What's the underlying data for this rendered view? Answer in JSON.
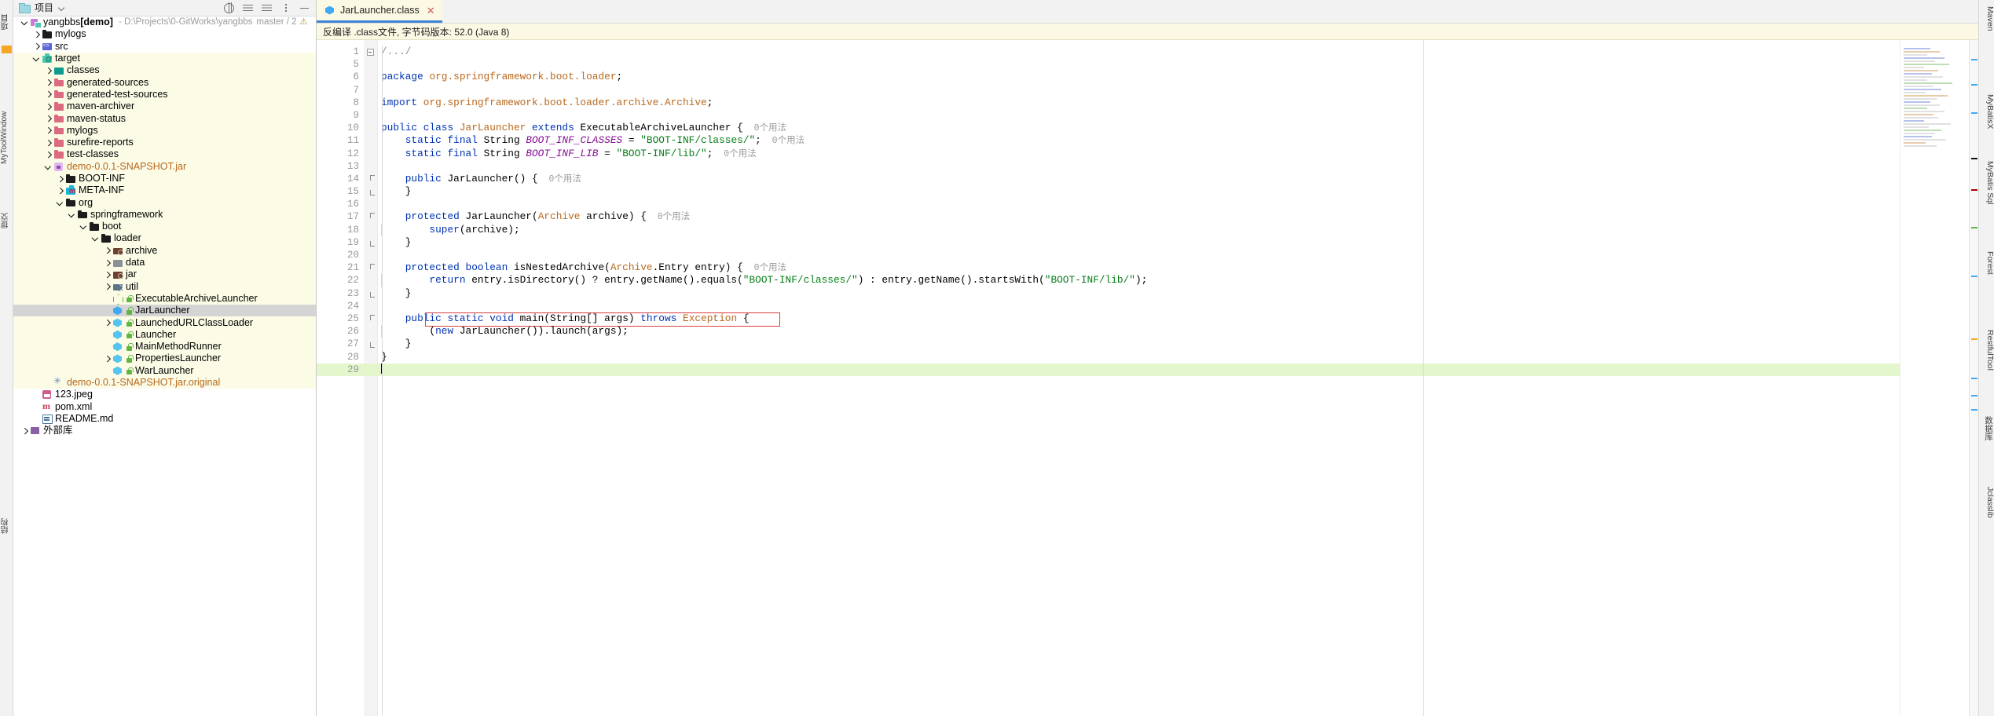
{
  "left_rail": {
    "project_label": "项目",
    "mytoolwindow_label": "MyToolWindow",
    "commit_label": "提交",
    "tiny_label": "结构"
  },
  "project_panel": {
    "header": {
      "title": "项目",
      "folder_icon": "folder-icon",
      "chevron_icon": "chevron-down-icon",
      "tools": [
        "globe-icon",
        "collapse-all-icon",
        "sort-icon",
        "more-options-icon",
        "hide-icon"
      ]
    },
    "tree": [
      {
        "depth": 0,
        "twist": "down",
        "icon": "module",
        "label": "yangbbs",
        "bold_suffix": "[demo]",
        "path": "- D:\\Projects\\0-GitWorks\\yangbbs",
        "branch": "master / 2",
        "warn": "⚠",
        "hl": false
      },
      {
        "depth": 1,
        "twist": "right",
        "icon": "fold black",
        "label": "mylogs",
        "hl": false
      },
      {
        "depth": 1,
        "twist": "right",
        "icon": "src",
        "label": "src",
        "hl": false
      },
      {
        "depth": 1,
        "twist": "down",
        "icon": "fold mint target",
        "label": "target",
        "hl": true
      },
      {
        "depth": 2,
        "twist": "right",
        "icon": "fold teal classesfold",
        "label": "classes",
        "hl": true
      },
      {
        "depth": 2,
        "twist": "right",
        "icon": "fold pink",
        "label": "generated-sources",
        "hl": true
      },
      {
        "depth": 2,
        "twist": "right",
        "icon": "fold pink",
        "label": "generated-test-sources",
        "hl": true
      },
      {
        "depth": 2,
        "twist": "right",
        "icon": "fold pink",
        "label": "maven-archiver",
        "hl": true
      },
      {
        "depth": 2,
        "twist": "right",
        "icon": "fold pink",
        "label": "maven-status",
        "hl": true
      },
      {
        "depth": 2,
        "twist": "right",
        "icon": "fold pink",
        "label": "mylogs",
        "hl": true
      },
      {
        "depth": 2,
        "twist": "right",
        "icon": "fold pink",
        "label": "surefire-reports",
        "hl": true
      },
      {
        "depth": 2,
        "twist": "right",
        "icon": "fold pink",
        "label": "test-classes",
        "hl": true
      },
      {
        "depth": 2,
        "twist": "down",
        "icon": "jarfile",
        "label": "demo-0.0.1-SNAPSHOT.jar",
        "orange": true,
        "hl": true
      },
      {
        "depth": 3,
        "twist": "right",
        "icon": "fold black",
        "label": "BOOT-INF",
        "hl": true
      },
      {
        "depth": 3,
        "twist": "right",
        "icon": "fold cyan metainf",
        "label": "META-INF",
        "hl": true
      },
      {
        "depth": 3,
        "twist": "down",
        "icon": "fold black",
        "label": "org",
        "hl": true
      },
      {
        "depth": 4,
        "twist": "down",
        "icon": "fold black",
        "label": "springframework",
        "hl": true
      },
      {
        "depth": 5,
        "twist": "down",
        "icon": "fold black",
        "label": "boot",
        "hl": true
      },
      {
        "depth": 6,
        "twist": "down",
        "icon": "fold black",
        "label": "loader",
        "hl": true
      },
      {
        "depth": 7,
        "twist": "right",
        "icon": "fold brown archfold",
        "label": "archive",
        "hl": true
      },
      {
        "depth": 7,
        "twist": "right",
        "icon": "fold gray datafold",
        "label": "data",
        "hl": true
      },
      {
        "depth": 7,
        "twist": "right",
        "icon": "fold brown archfold",
        "label": "jar",
        "hl": true
      },
      {
        "depth": 7,
        "twist": "right",
        "icon": "fold slate utilfold",
        "label": "util",
        "hl": true
      },
      {
        "depth": 7,
        "twist": "none",
        "icon": "clsg lockicon",
        "label": "ExecutableArchiveLauncher",
        "hl": true
      },
      {
        "depth": 7,
        "twist": "none",
        "icon": "cls lockicon",
        "label": "JarLauncher",
        "selected": true
      },
      {
        "depth": 7,
        "twist": "right",
        "icon": "clsb lockicon",
        "label": "LaunchedURLClassLoader",
        "hl": true
      },
      {
        "depth": 7,
        "twist": "none",
        "icon": "clsb lockicon",
        "label": "Launcher",
        "hl": true
      },
      {
        "depth": 7,
        "twist": "none",
        "icon": "clsb lockicon",
        "label": "MainMethodRunner",
        "hl": true
      },
      {
        "depth": 7,
        "twist": "right",
        "icon": "clsb lockicon",
        "label": "PropertiesLauncher",
        "hl": true
      },
      {
        "depth": 7,
        "twist": "none",
        "icon": "clsb lockicon",
        "label": "WarLauncher",
        "hl": true
      },
      {
        "depth": 2,
        "twist": "none",
        "icon": "jarorig",
        "label": "demo-0.0.1-SNAPSHOT.jar.original",
        "orange": true,
        "hl": true
      },
      {
        "depth": 1,
        "twist": "none",
        "icon": "img",
        "label": "123.jpeg",
        "hl": false
      },
      {
        "depth": 1,
        "twist": "none",
        "icon": "xml",
        "label": "pom.xml",
        "hl": false
      },
      {
        "depth": 1,
        "twist": "none",
        "icon": "md",
        "label": "README.md",
        "hl": false
      },
      {
        "depth": 0,
        "twist": "right",
        "icon": "ext",
        "label": "外部库",
        "hl": false
      }
    ]
  },
  "editor": {
    "tab": {
      "label": "JarLauncher.class",
      "icon": "java-class-icon",
      "close_icon": "close-icon"
    },
    "notice": "反编译 .class文件, 字节码版本: 52.0 (Java 8)",
    "lines": [
      {
        "num": "1",
        "fold": "plus",
        "tokens": [
          {
            "t": "/...",
            "c": "cmt"
          },
          {
            "t": "/",
            "c": "cmt"
          }
        ]
      },
      {
        "num": "5",
        "tokens": []
      },
      {
        "num": "6",
        "tokens": [
          {
            "t": "package ",
            "c": "k"
          },
          {
            "t": "org.springframework.boot.",
            "c": "cls"
          },
          {
            "t": "loader",
            "c": "cls"
          },
          {
            "t": ";",
            "c": "pl"
          }
        ]
      },
      {
        "num": "7",
        "tokens": []
      },
      {
        "num": "8",
        "tokens": [
          {
            "t": "import ",
            "c": "k"
          },
          {
            "t": "org.springframework.boot.loader.archive.",
            "c": "cls"
          },
          {
            "t": "Archive",
            "c": "cls"
          },
          {
            "t": ";",
            "c": "pl"
          }
        ]
      },
      {
        "num": "9",
        "tokens": []
      },
      {
        "num": "10",
        "run": true,
        "tokens": [
          {
            "t": "public class ",
            "c": "k"
          },
          {
            "t": "JarLauncher",
            "c": "cls"
          },
          {
            "t": " extends ",
            "c": "k"
          },
          {
            "t": "ExecutableArchiveLauncher",
            "c": "ty"
          },
          {
            "t": " {",
            "c": "pl"
          },
          {
            "t": "  0个用法",
            "c": "usage"
          }
        ]
      },
      {
        "num": "11",
        "tokens": [
          {
            "t": "    static final ",
            "c": "k"
          },
          {
            "t": "String ",
            "c": "ty"
          },
          {
            "t": "BOOT_INF_CLASSES",
            "c": "fld"
          },
          {
            "t": " = ",
            "c": "pl"
          },
          {
            "t": "\"BOOT-INF/classes/\"",
            "c": "s"
          },
          {
            "t": ";",
            "c": "pl"
          },
          {
            "t": "  0个用法",
            "c": "usage"
          }
        ]
      },
      {
        "num": "12",
        "tokens": [
          {
            "t": "    static final ",
            "c": "k"
          },
          {
            "t": "String ",
            "c": "ty"
          },
          {
            "t": "BOOT_INF_LIB",
            "c": "fld"
          },
          {
            "t": " = ",
            "c": "pl"
          },
          {
            "t": "\"BOOT-INF/lib/\"",
            "c": "s"
          },
          {
            "t": ";",
            "c": "pl"
          },
          {
            "t": "  0个用法",
            "c": "usage"
          }
        ]
      },
      {
        "num": "13",
        "tokens": []
      },
      {
        "num": "14",
        "fold": "top",
        "tokens": [
          {
            "t": "    public ",
            "c": "k"
          },
          {
            "t": "JarLauncher",
            "c": "ty"
          },
          {
            "t": "() {",
            "c": "pl"
          },
          {
            "t": "  0个用法",
            "c": "usage"
          }
        ]
      },
      {
        "num": "15",
        "fold": "bot",
        "tokens": [
          {
            "t": "    }",
            "c": "pl"
          }
        ]
      },
      {
        "num": "16",
        "tokens": []
      },
      {
        "num": "17",
        "fold": "top",
        "tokens": [
          {
            "t": "    protected ",
            "c": "k"
          },
          {
            "t": "JarLauncher",
            "c": "ty"
          },
          {
            "t": "(",
            "c": "pl"
          },
          {
            "t": "Archive",
            "c": "cls"
          },
          {
            "t": " archive) {",
            "c": "pl"
          },
          {
            "t": "  0个用法",
            "c": "usage"
          }
        ]
      },
      {
        "num": "18",
        "guide": true,
        "tokens": [
          {
            "t": "        super",
            "c": "k"
          },
          {
            "t": "(archive);",
            "c": "pl"
          }
        ]
      },
      {
        "num": "19",
        "fold": "bot",
        "tokens": [
          {
            "t": "    }",
            "c": "pl"
          }
        ]
      },
      {
        "num": "20",
        "tokens": []
      },
      {
        "num": "21",
        "fold": "top",
        "tokens": [
          {
            "t": "    protected boolean ",
            "c": "k"
          },
          {
            "t": "isNestedArchive(",
            "c": "pl"
          },
          {
            "t": "Archive",
            "c": "cls"
          },
          {
            "t": ".Entry entry) {",
            "c": "pl"
          },
          {
            "t": "  0个用法",
            "c": "usage"
          }
        ]
      },
      {
        "num": "22",
        "guide": true,
        "tokens": [
          {
            "t": "        return ",
            "c": "k"
          },
          {
            "t": "entry.isDirectory() ? entry.getName().equals(",
            "c": "pl"
          },
          {
            "t": "\"BOOT-INF/classes/\"",
            "c": "s"
          },
          {
            "t": ") : entry.getName().startsWith(",
            "c": "pl"
          },
          {
            "t": "\"BOOT-INF/lib/\"",
            "c": "s"
          },
          {
            "t": ");",
            "c": "pl"
          }
        ]
      },
      {
        "num": "23",
        "fold": "bot",
        "tokens": [
          {
            "t": "    }",
            "c": "pl"
          }
        ]
      },
      {
        "num": "24",
        "tokens": []
      },
      {
        "num": "25",
        "run": true,
        "fold": "top",
        "boxed": true,
        "tokens": [
          {
            "t": "    public static void ",
            "c": "k"
          },
          {
            "t": "main(",
            "c": "pl"
          },
          {
            "t": "String",
            "c": "ty"
          },
          {
            "t": "[] args) ",
            "c": "pl"
          },
          {
            "t": "throws ",
            "c": "k"
          },
          {
            "t": "Exception",
            "c": "cls"
          },
          {
            "t": " {",
            "c": "pl"
          }
        ]
      },
      {
        "num": "26",
        "guide": true,
        "tokens": [
          {
            "t": "        (",
            "c": "pl"
          },
          {
            "t": "new ",
            "c": "k"
          },
          {
            "t": "JarLauncher()).launch(args);",
            "c": "pl"
          }
        ]
      },
      {
        "num": "27",
        "fold": "bot",
        "tokens": [
          {
            "t": "    }",
            "c": "pl"
          }
        ]
      },
      {
        "num": "28",
        "tokens": [
          {
            "t": "}",
            "c": "pl"
          }
        ]
      },
      {
        "num": "29",
        "hl": true,
        "caret": true,
        "tokens": []
      }
    ]
  },
  "right_rail": {
    "items": [
      "Maven",
      "MyBatisX",
      "MyBatis Sql",
      "Forest",
      "RestfulTool",
      "数据库",
      "Jclasslib"
    ]
  },
  "colors": {
    "accent": "#3c86d8",
    "highlight_row": "#fbfbe6",
    "selected_row": "#d4d4d4",
    "current_line": "#e4f7cc",
    "error_box": "#d93f3f",
    "keyword": "#0033b3",
    "string": "#067d17",
    "field": "#871094",
    "class_ref": "#b8691e",
    "usage_hint": "#9a9a9a"
  }
}
